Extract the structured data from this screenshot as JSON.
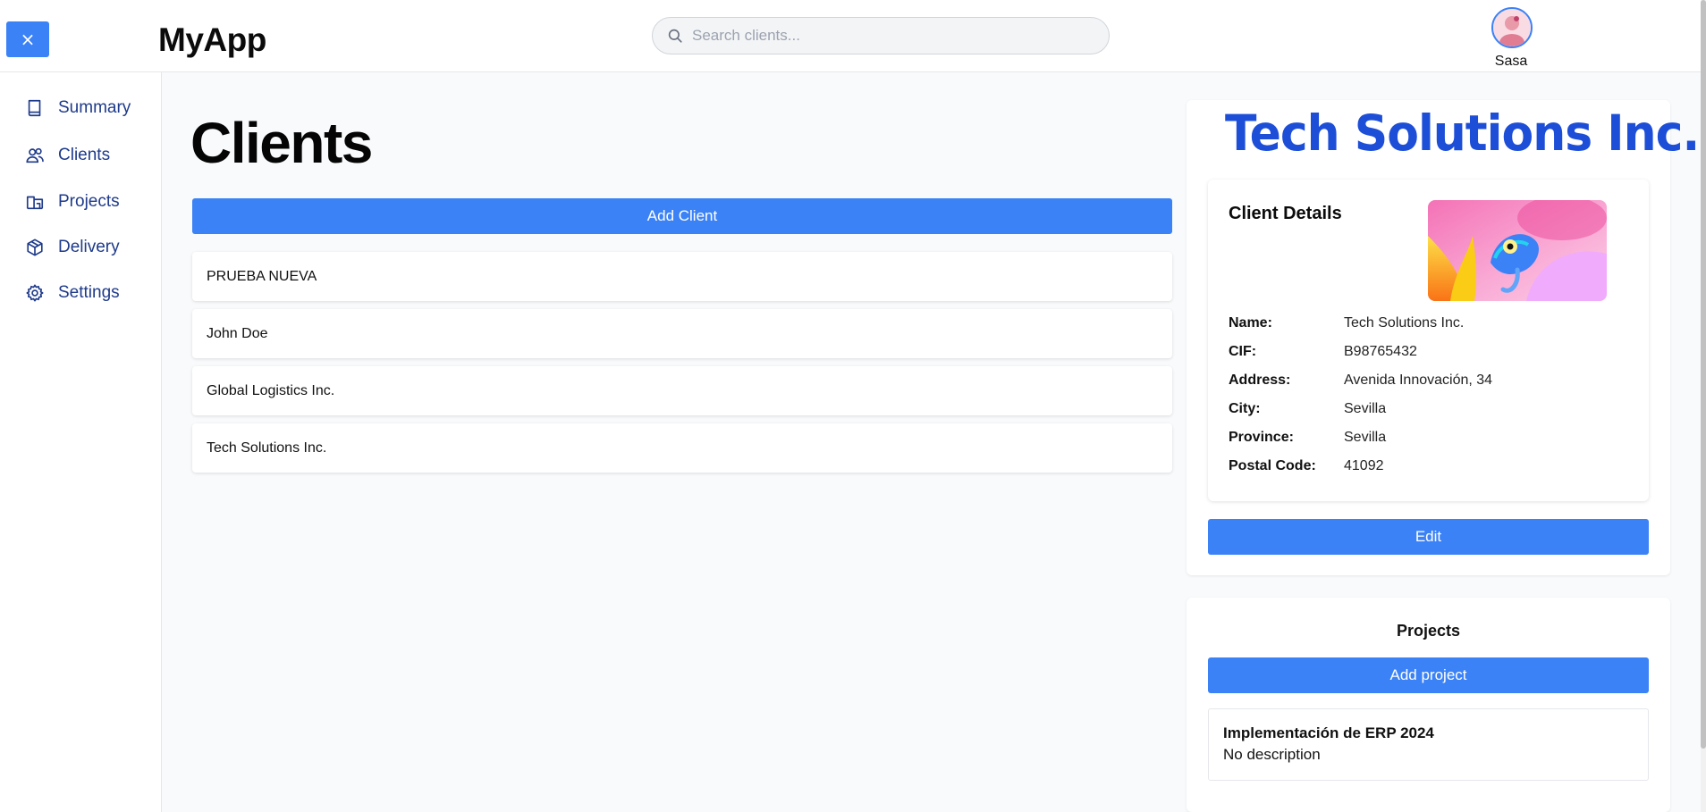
{
  "header": {
    "close_label": "×",
    "app_title": "MyApp",
    "search_placeholder": "Search clients...",
    "user_name": "Sasa"
  },
  "sidebar": {
    "items": [
      {
        "label": "Summary",
        "icon": "book-icon"
      },
      {
        "label": "Clients",
        "icon": "users-icon"
      },
      {
        "label": "Projects",
        "icon": "projects-icon"
      },
      {
        "label": "Delivery",
        "icon": "package-icon"
      },
      {
        "label": "Settings",
        "icon": "gear-icon"
      }
    ]
  },
  "main": {
    "title": "Clients",
    "add_client_label": "Add Client",
    "clients": [
      "PRUEBA NUEVA",
      "John Doe",
      "Global Logistics Inc.",
      "Tech Solutions Inc."
    ]
  },
  "details": {
    "logo_text": "Tech Solutions Inc.",
    "heading": "Client Details",
    "fields": [
      {
        "label": "Name:",
        "value": "Tech Solutions Inc."
      },
      {
        "label": "CIF:",
        "value": "B98765432"
      },
      {
        "label": "Address:",
        "value": "Avenida Innovación, 34"
      },
      {
        "label": "City:",
        "value": "Sevilla"
      },
      {
        "label": "Province:",
        "value": "Sevilla"
      },
      {
        "label": "Postal Code:",
        "value": "41092"
      }
    ],
    "edit_label": "Edit"
  },
  "projects": {
    "heading": "Projects",
    "add_label": "Add project",
    "items": [
      {
        "name": "Implementación de ERP 2024",
        "description": "No description"
      }
    ]
  },
  "colors": {
    "accent": "#3b82f6",
    "nav_text": "#1e3a8a",
    "logo": "#1d4ed8"
  }
}
